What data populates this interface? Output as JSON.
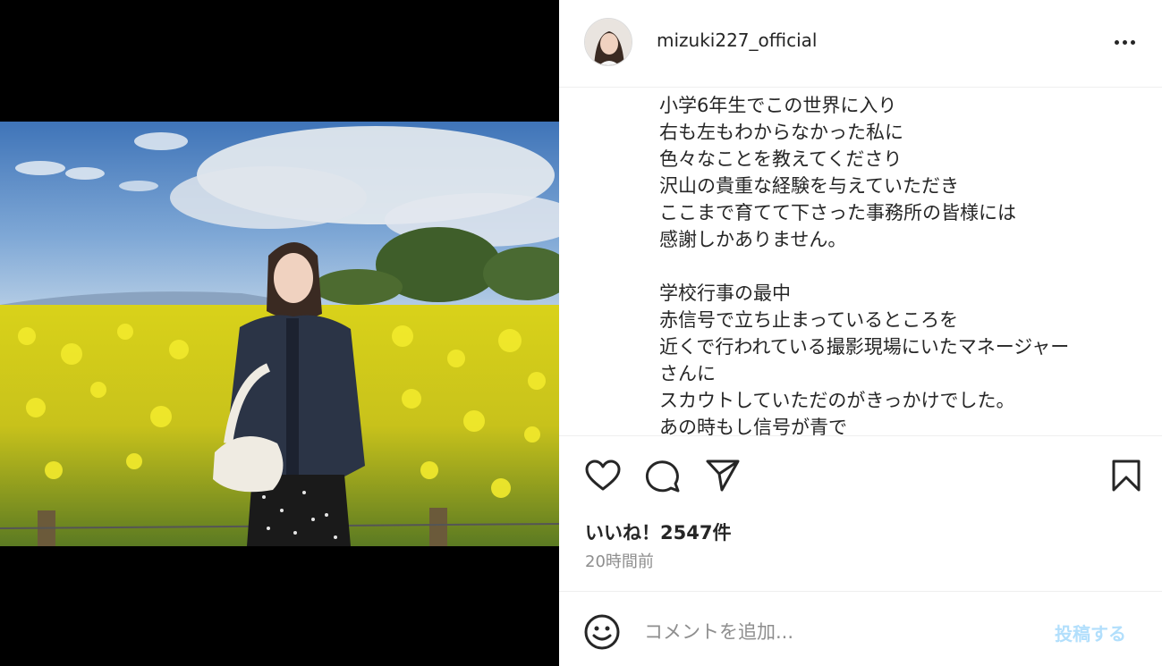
{
  "post": {
    "username": "mizuki227_official",
    "avatar_icon": "profile-photo",
    "more_icon": "more-horizontal-icon"
  },
  "caption": {
    "lines": [
      "小学6年生でこの世界に入り",
      "右も左もわからなかった私に",
      "色々なことを教えてくださり",
      "沢山の貴重な経験を与えていただき",
      "ここまで育てて下さった事務所の皆様には",
      "感謝しかありません。",
      "",
      "学校行事の最中",
      "赤信号で立ち止まっているところを",
      "近くで行われている撮影現場にいたマネージャー",
      "さんに",
      "スカウトしていただのがきっかけでした。",
      "あの時もし信号が青で"
    ]
  },
  "actions": {
    "like_icon": "heart-icon",
    "comment_icon": "comment-icon",
    "share_icon": "send-icon",
    "save_icon": "bookmark-icon"
  },
  "likes_text": "いいね！2547件",
  "timestamp": "20時間前",
  "comment": {
    "emoji_icon": "emoji-icon",
    "placeholder": "コメントを追加...",
    "post_label": "投稿する"
  },
  "colors": {
    "text": "#262626",
    "secondary_text": "#8e8e8e",
    "post_button_disabled": "#b2dffc",
    "divider": "#efefef",
    "media_background": "#000000"
  }
}
